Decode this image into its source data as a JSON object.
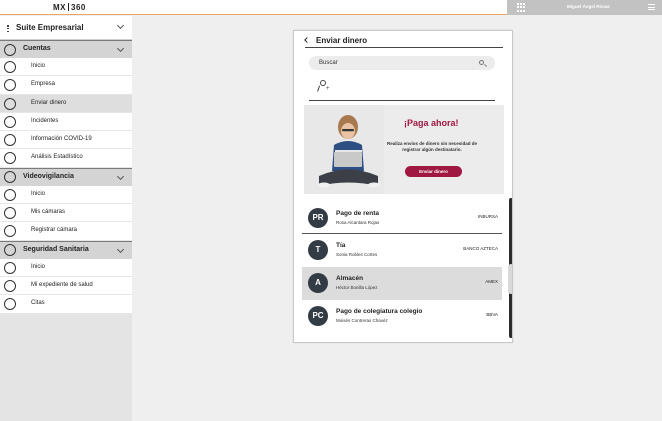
{
  "header": {
    "logo_left": "MX",
    "logo_right": "360",
    "user_name": "Miguel Ángel Rosas"
  },
  "sidebar": {
    "suite_title": "Suite Empresarial",
    "groups": [
      {
        "label": "Cuentas",
        "items": [
          "Inicio",
          "Empresa",
          "Enviar dinero",
          "Incidentes",
          "Información COVID-19",
          "Análisis Estadístico"
        ]
      },
      {
        "label": "Videovigilancia",
        "items": [
          "Inicio",
          "Mis cámaras",
          "Registrar cámara"
        ]
      },
      {
        "label": "Seguridad Sanitaria",
        "items": [
          "Inicio",
          "Mi expediente de salud",
          "Citas"
        ]
      }
    ],
    "active_item": "Enviar dinero"
  },
  "panel": {
    "title": "Enviar dinero",
    "search_placeholder": "Buscar",
    "banner": {
      "headline": "¡Paga ahora!",
      "subtext": "Realiza envíos de dinero sin necesidad de registrar algún destinatario.",
      "cta": "Enviar dinero",
      "accent": "#a01842"
    },
    "recipients": [
      {
        "initials": "PR",
        "name": "Pago de renta",
        "contact": "Rosa Alcantara Rojas",
        "bank": "INBURSA"
      },
      {
        "initials": "T",
        "name": "Tía",
        "contact": "Sonia Robles Cortes",
        "bank": "BANCO AZTECA"
      },
      {
        "initials": "A",
        "name": "Almacén",
        "contact": "Héctor Bonilla López",
        "bank": "AMEX"
      },
      {
        "initials": "PC",
        "name": "Pago de colegiatura colegio",
        "contact": "Moisés Contreras Chavéz",
        "bank": "BBVA"
      }
    ]
  }
}
